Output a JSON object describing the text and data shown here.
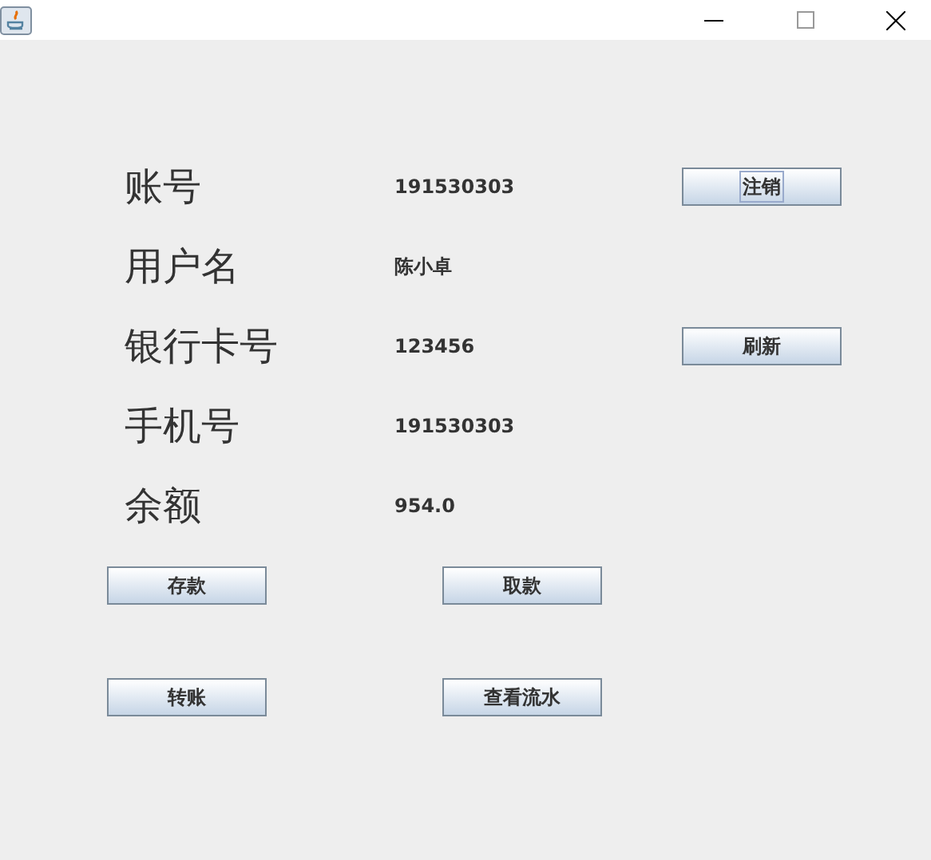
{
  "fields": [
    {
      "label": "账号",
      "value": "191530303",
      "button": {
        "label": "注销",
        "focused": true
      }
    },
    {
      "label": "用户名",
      "value": "陈小卓"
    },
    {
      "label": "银行卡号",
      "value": "123456",
      "button": {
        "label": "刷新",
        "focused": false
      }
    },
    {
      "label": "手机号",
      "value": "191530303"
    },
    {
      "label": "余额",
      "value": "954.0"
    }
  ],
  "actions": [
    {
      "label": "存款",
      "focused": false
    },
    {
      "label": "取款",
      "focused": false
    },
    {
      "label": "转账",
      "focused": false
    },
    {
      "label": "查看流水",
      "focused": false
    }
  ]
}
